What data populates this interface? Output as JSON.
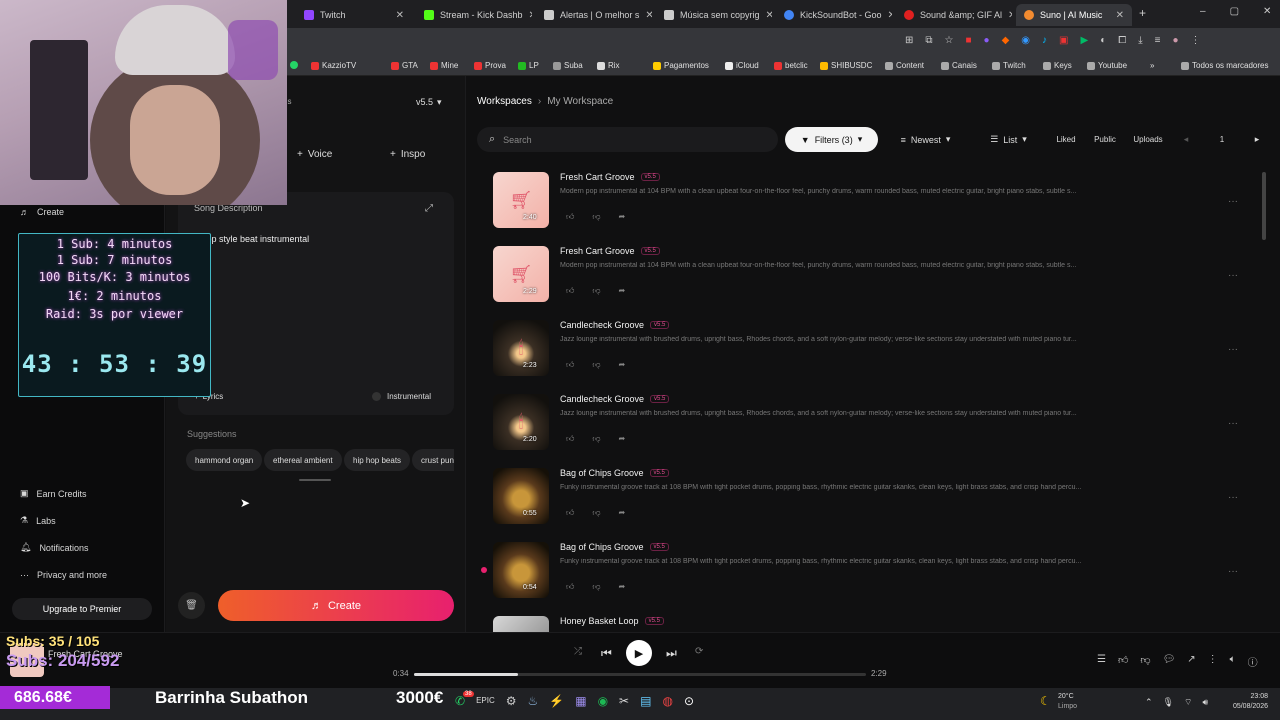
{
  "browser": {
    "tabs": [
      {
        "label": "Twitch",
        "color": "#9146ff"
      },
      {
        "label": "Stream - Kick Dashb",
        "color": "#53fc18"
      },
      {
        "label": "Alertas | O melhor s",
        "color": "#cccccc"
      },
      {
        "label": "Música sem copyrig",
        "color": "#cccccc"
      },
      {
        "label": "KickSoundBot - Goo",
        "color": "#4285f4"
      },
      {
        "label": "Sound &amp; GIF Al",
        "color": "#e02020"
      },
      {
        "label": "Suno | AI Music",
        "color": "#f28b30"
      }
    ],
    "bookmarks": [
      "KazzioTV",
      "GTA",
      "Mine",
      "Prova",
      "LP",
      "Suba",
      "Rix",
      "Pagamentos",
      "iCloud",
      "betclic",
      "SHIBUSDC",
      "Content",
      "Canais",
      "Twitch",
      "Keys",
      "Youtube",
      "Todos os marcadores"
    ]
  },
  "sidebar": {
    "create": "Create",
    "bottom_items": [
      "Earn Credits",
      "Labs",
      "Notifications",
      "Privacy and more"
    ],
    "upgrade": "Upgrade to Premier"
  },
  "create_panel": {
    "version": "v5.5",
    "tabs_partial": "ds",
    "voice": "Voice",
    "inspo": "Inspo",
    "song_description_label": "Song Description",
    "song_description_value": "hip hop style beat instrumental",
    "lyrics": "Lyrics",
    "instrumental": "Instrumental",
    "suggestions_label": "Suggestions",
    "suggestions": [
      "hammond organ",
      "ethereal ambient",
      "hip hop beats",
      "crust punl"
    ],
    "create_button": "Create"
  },
  "workspace": {
    "breadcrumb_root": "Workspaces",
    "breadcrumb_current": "My Workspace",
    "search_placeholder": "Search",
    "filters": "Filters (3)",
    "sort": "Newest",
    "view": "List",
    "liked": "Liked",
    "public": "Public",
    "uploads": "Uploads",
    "page": "1",
    "songs": [
      {
        "title": "Fresh Cart Groove",
        "version": "v5.5",
        "duration": "2:40",
        "desc": "Modern pop instrumental at 104 BPM with a clean upbeat four-on-the-floor feel, punchy drums, warm rounded bass, muted electric guitar, bright piano stabs, subtle s...",
        "thumb": "cart"
      },
      {
        "title": "Fresh Cart Groove",
        "version": "v5.5",
        "duration": "2:29",
        "desc": "Modern pop instrumental at 104 BPM with a clean upbeat four-on-the-floor feel, punchy drums, warm rounded bass, muted electric guitar, bright piano stabs, subtle s...",
        "thumb": "cart"
      },
      {
        "title": "Candlecheck Groove",
        "version": "v5.5",
        "duration": "2:23",
        "desc": "Jazz lounge instrumental with brushed drums, upright bass, Rhodes chords, and a soft nylon-guitar melody; verse-like sections stay understated with muted piano tur...",
        "thumb": "candle"
      },
      {
        "title": "Candlecheck Groove",
        "version": "v5.5",
        "duration": "2:20",
        "desc": "Jazz lounge instrumental with brushed drums, upright bass, Rhodes chords, and a soft nylon-guitar melody; verse-like sections stay understated with muted piano tur...",
        "thumb": "candle"
      },
      {
        "title": "Bag of Chips Groove",
        "version": "v5.5",
        "duration": "0:55",
        "desc": "Funky instrumental groove track at 108 BPM with tight pocket drums, popping bass, rhythmic electric guitar skanks, clean keys, light brass stabs, and crisp hand percu...",
        "thumb": "chips"
      },
      {
        "title": "Bag of Chips Groove",
        "version": "v5.5",
        "duration": "0:54",
        "desc": "Funky instrumental groove track at 108 BPM with tight pocket drums, popping bass, rhythmic electric guitar skanks, clean keys, light brass stabs, and crisp hand percu...",
        "thumb": "chips"
      },
      {
        "title": "Honey Basket Loop",
        "version": "v5.5",
        "duration": "",
        "desc": "",
        "thumb": "honey"
      }
    ]
  },
  "player": {
    "now_playing": "Fresh Cart Groove",
    "elapsed": "0:34",
    "total": "2:29",
    "progress": 0.23
  },
  "overlay": {
    "timer_lines": [
      "1 Sub: 4 minutos",
      "1 Sub: 7 minutos",
      "100 Bits/K: 3 minutos",
      "1€: 2 minutos",
      "Raid: 3s por viewer"
    ],
    "big_timer": "43 : 53 : 39",
    "subs1": "Subs: 35 / 105",
    "subs2": "Subs: 204/592",
    "money": "686.68€",
    "subathon": "Barrinha Subathon",
    "goal": "3000€"
  },
  "taskbar": {
    "weather_temp": "20°C",
    "weather_desc": "Limpo",
    "time": "23:08",
    "date": "05/08/2026",
    "badge": "38"
  }
}
